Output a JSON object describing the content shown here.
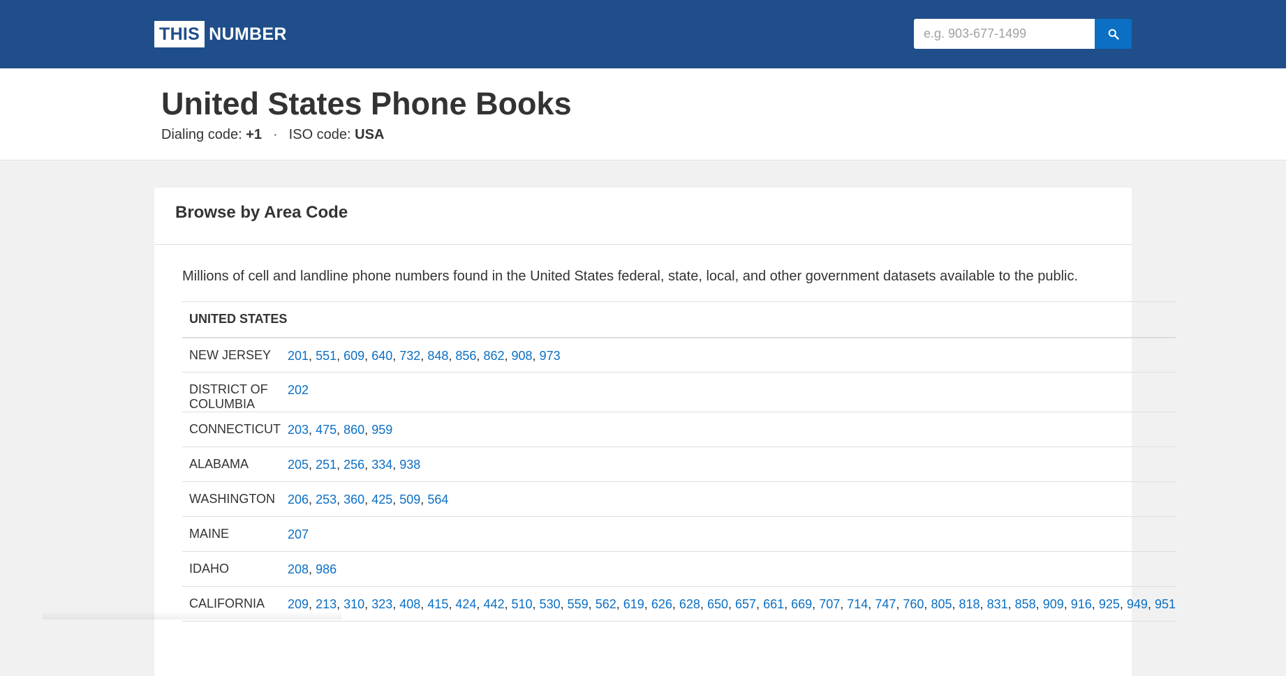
{
  "header": {
    "logo_box": "THIS",
    "logo_text": "NUMBER",
    "search_placeholder": "e.g. 903-677-1499",
    "search_icon": "search-icon"
  },
  "title_section": {
    "title": "United States Phone Books",
    "dialing_label": "Dialing code: ",
    "dialing_value": "+1",
    "separator": "·",
    "iso_label": "ISO code: ",
    "iso_value": "USA"
  },
  "card": {
    "title": "Browse by Area Code",
    "description": "Millions of cell and landline phone numbers found in the United States federal, state, local, and other government datasets available to the public.",
    "table_header": "UNITED STATES",
    "rows": [
      {
        "state": "NEW JERSEY",
        "codes": [
          "201",
          "551",
          "609",
          "640",
          "732",
          "848",
          "856",
          "862",
          "908",
          "973"
        ]
      },
      {
        "state": "DISTRICT OF COLUMBIA",
        "codes": [
          "202"
        ]
      },
      {
        "state": "CONNECTICUT",
        "codes": [
          "203",
          "475",
          "860",
          "959"
        ]
      },
      {
        "state": "ALABAMA",
        "codes": [
          "205",
          "251",
          "256",
          "334",
          "938"
        ]
      },
      {
        "state": "WASHINGTON",
        "codes": [
          "206",
          "253",
          "360",
          "425",
          "509",
          "564"
        ]
      },
      {
        "state": "MAINE",
        "codes": [
          "207"
        ]
      },
      {
        "state": "IDAHO",
        "codes": [
          "208",
          "986"
        ]
      },
      {
        "state": "CALIFORNIA",
        "codes": [
          "209",
          "213",
          "310",
          "323",
          "408",
          "415",
          "424",
          "442",
          "510",
          "530",
          "559",
          "562",
          "619",
          "626",
          "628",
          "650",
          "657",
          "661",
          "669",
          "707",
          "714",
          "747",
          "760",
          "805",
          "818",
          "831",
          "858",
          "909",
          "916",
          "925",
          "949",
          "951"
        ]
      }
    ]
  },
  "colors": {
    "header_bg": "#1f4e8a",
    "search_button": "#0b6fc4",
    "link": "#0b6fc4"
  }
}
